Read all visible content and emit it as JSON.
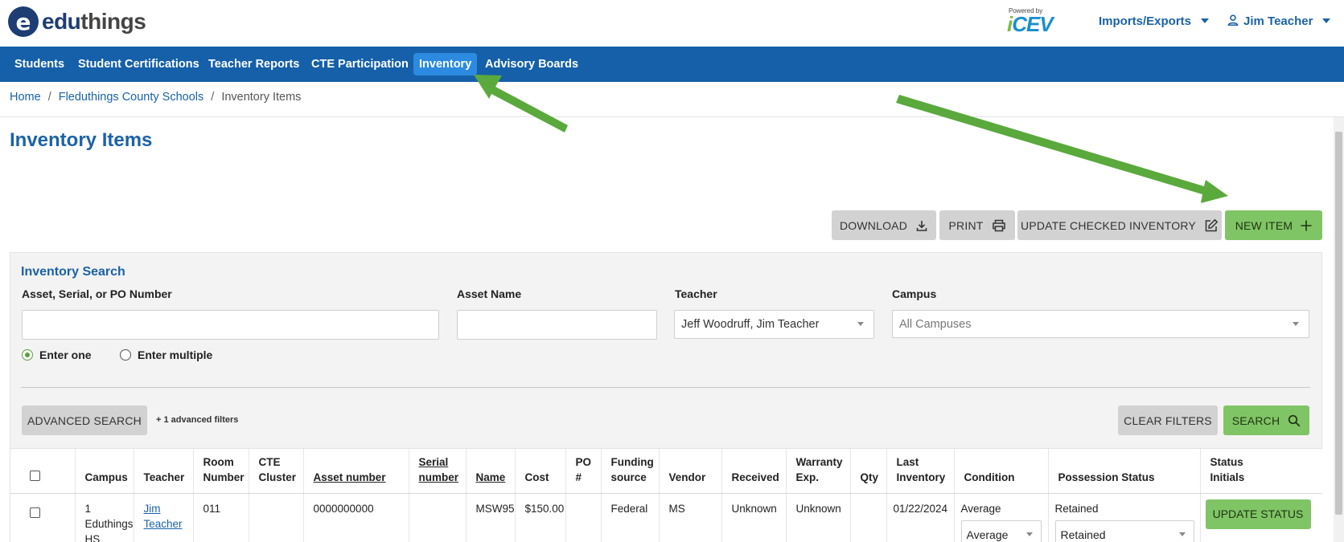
{
  "header": {
    "logo_mark": "e",
    "logo_edu": "edu",
    "logo_things": "things",
    "powered_by": "Powered by",
    "icev_i": "i",
    "icev_rest": "CEV",
    "imports_exports": "Imports/Exports",
    "user_name": "Jim Teacher"
  },
  "nav": {
    "items": [
      "Students",
      "Student Certifications",
      "Teacher Reports",
      "CTE Participation",
      "Inventory",
      "Advisory Boards"
    ],
    "active": "Inventory"
  },
  "breadcrumb": {
    "home": "Home",
    "district": "Fleduthings County Schools",
    "current": "Inventory Items",
    "separator": "/"
  },
  "page": {
    "title": "Inventory Items"
  },
  "toolbar": {
    "download": "DOWNLOAD",
    "print": "PRINT",
    "update_checked": "UPDATE CHECKED INVENTORY",
    "new_item": "NEW ITEM"
  },
  "search": {
    "title": "Inventory Search",
    "asset_label": "Asset, Serial, or PO Number",
    "asset_value": "",
    "name_label": "Asset Name",
    "name_value": "",
    "teacher_label": "Teacher",
    "teacher_value": "Jeff Woodruff, Jim Teacher",
    "campus_label": "Campus",
    "campus_placeholder": "All Campuses",
    "radio_one": "Enter one",
    "radio_multiple": "Enter multiple",
    "advanced_search": "ADVANCED SEARCH",
    "advanced_note": "+ 1 advanced filters",
    "clear_filters": "CLEAR FILTERS",
    "search_button": "SEARCH"
  },
  "table": {
    "headers": {
      "campus": "Campus",
      "teacher": "Teacher",
      "room_1": "Room",
      "room_2": "Number",
      "cte_1": "CTE",
      "cte_2": "Cluster",
      "asset_number": "Asset number",
      "serial_1": "Serial",
      "serial_2": "number",
      "name": "Name",
      "cost": "Cost",
      "po_1": "PO",
      "po_2": "#",
      "funding_1": "Funding",
      "funding_2": "source",
      "vendor": "Vendor",
      "received": "Received",
      "warranty_1": "Warranty",
      "warranty_2": "Exp.",
      "qty": "Qty",
      "last_inv_1": "Last",
      "last_inv_2": "Inventory",
      "condition": "Condition",
      "possession": "Possession Status",
      "status_1": "Status",
      "status_2": "Initials"
    },
    "rows": [
      {
        "campus_1": "1",
        "campus_2": "Eduthings",
        "campus_3": "HS",
        "teacher_1": "Jim",
        "teacher_2": "Teacher",
        "room": "011",
        "cte": "",
        "asset_number": "0000000000",
        "serial": "",
        "name": "MSW95",
        "cost": "$150.00",
        "po": "",
        "funding": "Federal",
        "vendor": "MS",
        "received": "Unknown",
        "warranty": "Unknown",
        "qty": "",
        "last_inventory": "01/22/2024",
        "condition_text": "Average",
        "condition_select": "Average",
        "possession_text": "Retained",
        "possession_select": "Retained",
        "update_status": "UPDATE STATUS"
      }
    ]
  },
  "colors": {
    "nav_bg": "#1560a8",
    "nav_active": "#2c8be0",
    "primary_text": "#1b62a6",
    "green_button": "#80c565",
    "gray_button": "#d2d2d2",
    "annotation_arrow": "#5aa93c"
  }
}
